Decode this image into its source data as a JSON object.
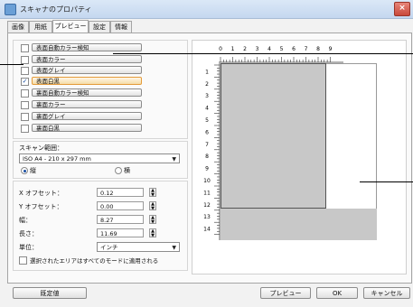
{
  "window": {
    "title": "スキャナのプロパティ",
    "close_label": "×"
  },
  "tabs": [
    {
      "label": "画像"
    },
    {
      "label": "用紙"
    },
    {
      "label": "プレビュー"
    },
    {
      "label": "設定"
    },
    {
      "label": "情報"
    }
  ],
  "modes": [
    {
      "label": "表面自動カラー検知",
      "checked": false
    },
    {
      "label": "表面カラー",
      "checked": false
    },
    {
      "label": "表面グレイ",
      "checked": false
    },
    {
      "label": "表面白黒",
      "checked": true
    },
    {
      "label": "裏面自動カラー検知",
      "checked": false
    },
    {
      "label": "裏面カラー",
      "checked": false
    },
    {
      "label": "裏面グレイ",
      "checked": false
    },
    {
      "label": "裏面白黒",
      "checked": false
    }
  ],
  "check_mark": "✓",
  "scan_area": {
    "label": "スキャン範囲：",
    "value": "ISO A4 - 210 x 297 mm",
    "orientation_portrait": "縦",
    "orientation_landscape": "横"
  },
  "offsets": {
    "x_label": "X オフセット：",
    "x_value": "0.12",
    "y_label": "Y オフセット：",
    "y_value": "0.00",
    "width_label": "幅：",
    "width_value": "8.27",
    "length_label": "長さ：",
    "length_value": "11.69"
  },
  "unit": {
    "label": "単位：",
    "value": "インチ"
  },
  "apply_all_label": "選択されたエリアはすべてのモードに適用される",
  "ruler": {
    "h_labels": [
      "0",
      "1",
      "2",
      "3",
      "4",
      "5",
      "6",
      "7",
      "8",
      "9"
    ],
    "v_labels": [
      "1",
      "2",
      "3",
      "4",
      "5",
      "6",
      "7",
      "8",
      "9",
      "10",
      "11",
      "12",
      "13",
      "14"
    ]
  },
  "buttons": {
    "default": "既定値",
    "preview": "プレビュー",
    "ok": "OK",
    "cancel": "キャンセル"
  }
}
